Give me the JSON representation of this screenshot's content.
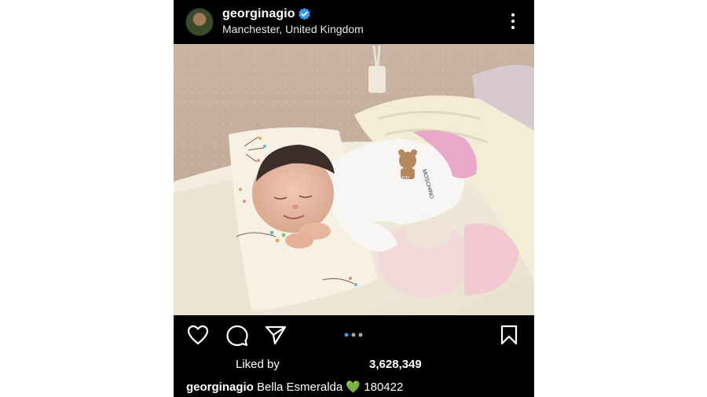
{
  "post": {
    "username": "georginagio",
    "location": "Manchester, United Kingdom",
    "icons": {
      "avatar": "profile-photo",
      "verified": "verified-badge-icon",
      "more": "more-options-icon",
      "like": "heart-outline-icon",
      "comment": "comment-bubble-icon",
      "share": "paper-plane-icon",
      "save": "bookmark-icon",
      "carousel": "carousel-dots-icon"
    },
    "likes_label": "Liked by",
    "likes_count": "3,628,349",
    "caption_user": "georginagio",
    "caption_text": "Bella Esmeralda",
    "caption_emoji": "💚",
    "caption_suffix": "180422",
    "photo_text": {
      "toy_brand": "MOSCHINO",
      "toy_label": "TOY"
    }
  },
  "colors": {
    "verified": "#3897f0",
    "emoji_green": "#7acb3a",
    "carousel_active": "#3897f0"
  }
}
